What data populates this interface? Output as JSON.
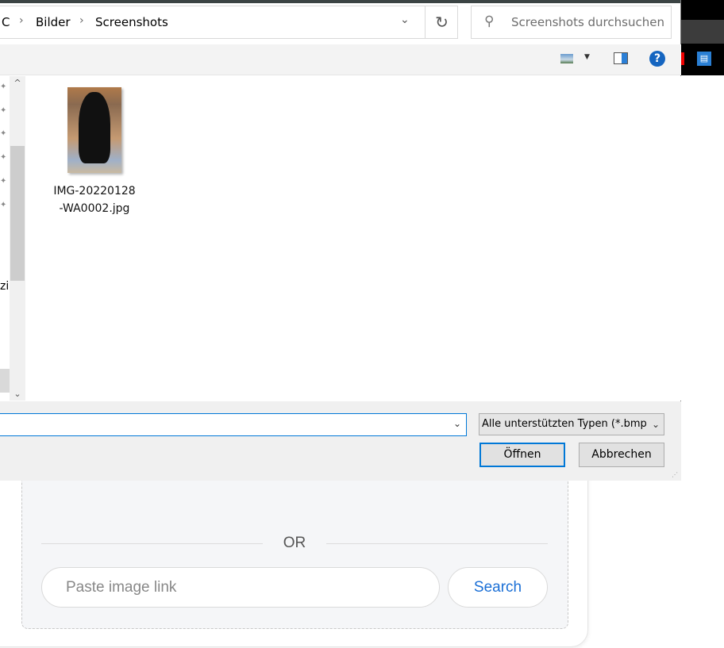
{
  "dialog": {
    "breadcrumb": [
      "C",
      "Bilder",
      "Screenshots"
    ],
    "search_placeholder": "Screenshots durchsuchen",
    "help_label": "?",
    "nav_partial_text": "zi",
    "files": [
      {
        "name_line1": "IMG-20220128",
        "name_line2": "-WA0002.jpg"
      }
    ],
    "filename_value": "",
    "filter_value": "Alle unterstützten Typen (*.bmp",
    "open_label": "Öffnen",
    "cancel_label": "Abbrechen"
  },
  "page": {
    "or_label": "OR",
    "paste_placeholder": "Paste image link",
    "search_label": "Search"
  }
}
